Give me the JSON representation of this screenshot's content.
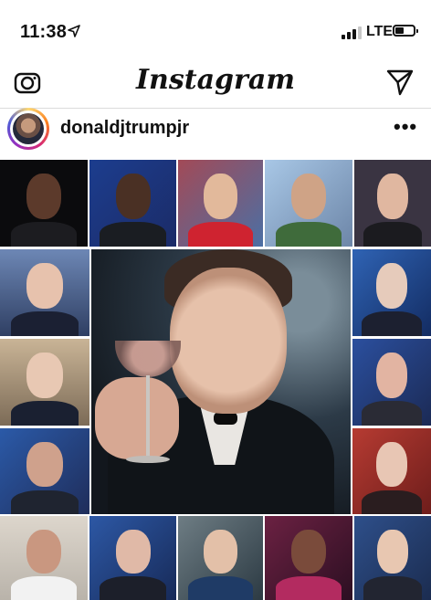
{
  "status_bar": {
    "time": "11:38",
    "network": "LTE",
    "location_icon": "location-arrow-icon",
    "signal_bars_active": 3,
    "battery_level": 0.35
  },
  "nav": {
    "brand": "Instagram",
    "left_icon": "camera-icon",
    "right_icon": "paper-plane-icon"
  },
  "post": {
    "username": "donaldjtrumpjr",
    "more_label": "•••"
  },
  "colors": {
    "text": "#111111",
    "divider": "#dbdbdb",
    "ring_start": "#feda75",
    "ring_end": "#962fbf"
  }
}
